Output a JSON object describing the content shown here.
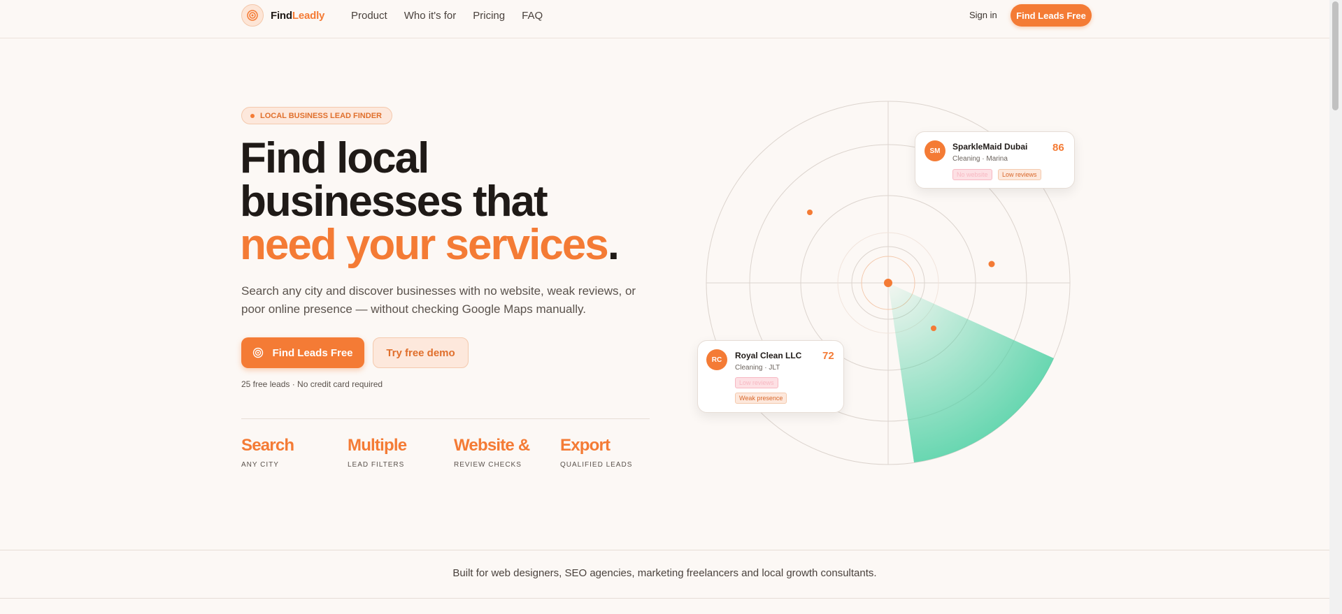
{
  "nav": {
    "brand_a": "Find",
    "brand_b": "Leadly",
    "links": [
      "Product",
      "Who it's for",
      "Pricing",
      "FAQ"
    ],
    "signin": "Sign in",
    "cta": "Find Leads Free"
  },
  "hero": {
    "badge": "LOCAL BUSINESS LEAD FINDER",
    "title_line1": "Find local",
    "title_line2": "businesses that",
    "title_accent": "need your services",
    "title_period": ".",
    "subtitle": "Search any city and discover businesses with no website, weak reviews, or poor online presence — without checking Google Maps manually.",
    "primary_button": "Find Leads Free",
    "secondary_button": "Try free demo",
    "note": "25 free leads · No credit card required"
  },
  "stats": [
    {
      "title": "Search",
      "label": "ANY CITY"
    },
    {
      "title": "Multiple",
      "label": "LEAD FILTERS"
    },
    {
      "title": "Website &",
      "label": "REVIEW CHECKS"
    },
    {
      "title": "Export",
      "label": "QUALIFIED LEADS"
    }
  ],
  "cards": {
    "top": {
      "initials": "SM",
      "name": "SparkleMaid Dubai",
      "meta": "Cleaning · Marina",
      "score": "86",
      "tag1": "No website",
      "tag2": "Low reviews"
    },
    "bottom": {
      "initials": "RC",
      "name": "Royal Clean LLC",
      "meta": "Cleaning · JLT",
      "score": "72",
      "tag1": "Low reviews",
      "tag2": "Weak presence"
    }
  },
  "colors": {
    "accent": "#f47b35",
    "radar_sweep": "#4fd1a5",
    "background": "#fcf8f5"
  },
  "footer_band": {
    "text": "Built for web designers, SEO agencies, marketing freelancers and local growth consultants."
  }
}
